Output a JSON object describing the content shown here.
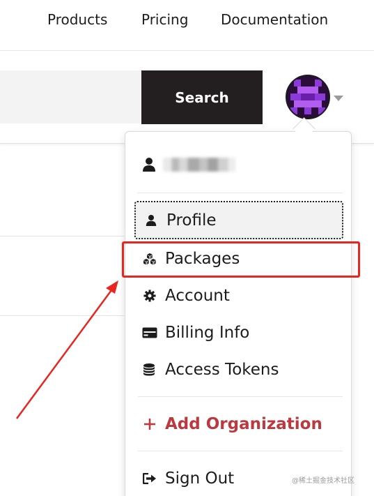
{
  "topnav": {
    "links": [
      {
        "label": "Products"
      },
      {
        "label": "Pricing"
      },
      {
        "label": "Documentation"
      }
    ]
  },
  "search": {
    "placeholder": "",
    "button_label": "Search"
  },
  "avatar": {
    "icon": "pixel-avatar",
    "colors": {
      "dark": "#2a0d3a",
      "purple": "#8a3ad6",
      "light": "#b35df0"
    }
  },
  "dropdown": {
    "username": "",
    "items": [
      {
        "label": "Profile",
        "icon": "user-icon"
      },
      {
        "label": "Packages",
        "icon": "packages-icon"
      },
      {
        "label": "Account",
        "icon": "gear-icon"
      },
      {
        "label": "Billing Info",
        "icon": "credit-card-icon"
      },
      {
        "label": "Access Tokens",
        "icon": "coins-icon"
      }
    ],
    "add_org_label": "Add Organization",
    "add_org_color": "#bc3a3f",
    "sign_out_label": "Sign Out"
  },
  "annotation": {
    "highlight_color": "#e8261f"
  },
  "watermark": "@稀土掘金技术社区"
}
